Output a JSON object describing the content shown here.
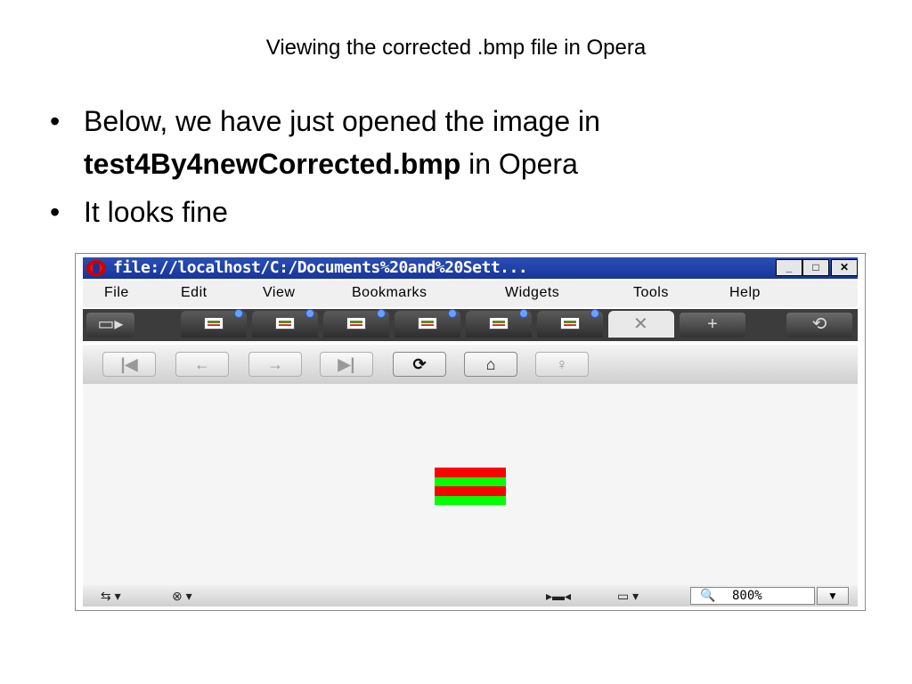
{
  "slide": {
    "title": "Viewing the corrected .bmp file in Opera",
    "bullets": [
      {
        "marker": "•",
        "pre": " Below, we have just opened the image in",
        "bold": "test4By4newCorrected.bmp",
        "post": " in Opera"
      },
      {
        "marker": "•",
        "pre": "It looks fine",
        "bold": "",
        "post": ""
      }
    ]
  },
  "browser": {
    "title": "file://localhost/C:/Documents%20and%20Sett...",
    "window_buttons": {
      "minimize": "_",
      "maximize": "□",
      "close": "✕"
    },
    "menu": [
      "File",
      "Edit",
      "View",
      "Bookmarks",
      "Widgets",
      "Tools",
      "Help"
    ],
    "tabs": {
      "count": 6,
      "active_close": "✕",
      "new_tab": "+",
      "trash": "⟲"
    },
    "toolbar": {
      "first": "|◀",
      "back": "←",
      "forward": "→",
      "last": "▶|",
      "reload": "⟳",
      "home": "⌂",
      "wand": "♀"
    },
    "image_colors": [
      "#ff0000",
      "#00ff00",
      "#ff0000",
      "#00ff00"
    ],
    "status": {
      "left_icons": [
        "⇆ ▾",
        "⊗ ▾"
      ],
      "panel": "▸▬◂",
      "view": "▭ ▾",
      "zoom_icon": "🔍",
      "zoom": "800%",
      "zoom_dropdown": "▼"
    }
  }
}
